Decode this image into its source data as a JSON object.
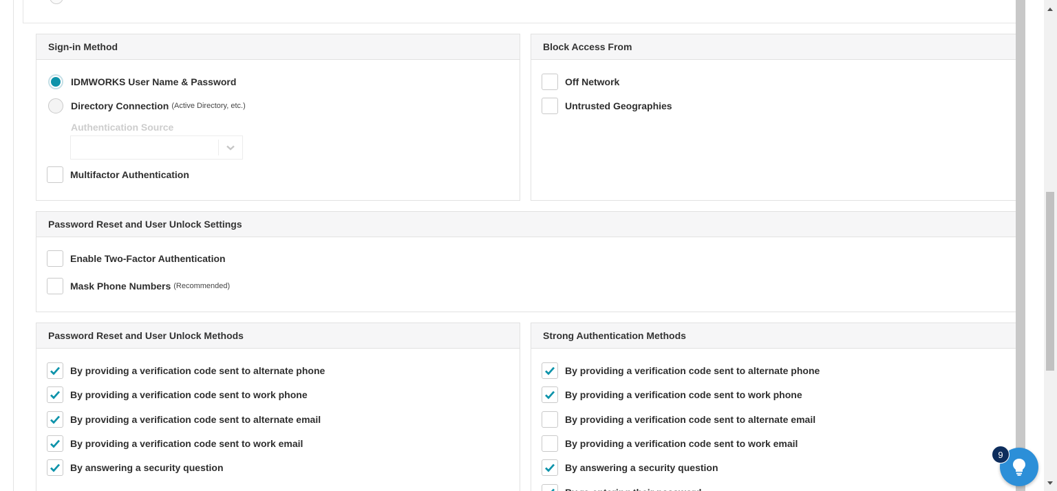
{
  "sign_in": {
    "title": "Sign-in Method",
    "options": [
      {
        "label": "IDMWORKS User Name & Password",
        "note": "",
        "selected": true
      },
      {
        "label": "Directory Connection",
        "note": "(Active Directory, etc.)",
        "selected": false
      }
    ],
    "auth_source_label": "Authentication Source",
    "auth_source_value": "",
    "mfa_label": "Multifactor Authentication",
    "mfa_checked": false
  },
  "block_access": {
    "title": "Block Access From",
    "items": [
      {
        "label": "Off Network",
        "checked": false
      },
      {
        "label": "Untrusted Geographies",
        "checked": false
      }
    ]
  },
  "reset_settings": {
    "title": "Password Reset and User Unlock Settings",
    "items": [
      {
        "label": "Enable Two-Factor Authentication",
        "note": "",
        "checked": false
      },
      {
        "label": "Mask Phone Numbers",
        "note": "(Recommended)",
        "checked": false
      }
    ]
  },
  "reset_methods": {
    "title": "Password Reset and User Unlock Methods",
    "items": [
      {
        "label": "By providing a verification code sent to alternate phone",
        "checked": true
      },
      {
        "label": "By providing a verification code sent to work phone",
        "checked": true
      },
      {
        "label": "By providing a verification code sent to alternate email",
        "checked": true
      },
      {
        "label": "By providing a verification code sent to work email",
        "checked": true
      },
      {
        "label": "By answering a security question",
        "checked": true
      }
    ]
  },
  "strong_auth": {
    "title": "Strong Authentication Methods",
    "items": [
      {
        "label": "By providing a verification code sent to alternate phone",
        "checked": true
      },
      {
        "label": "By providing a verification code sent to work phone",
        "checked": true
      },
      {
        "label": "By providing a verification code sent to alternate email",
        "checked": false
      },
      {
        "label": "By providing a verification code sent to work email",
        "checked": false
      },
      {
        "label": "By answering a security question",
        "checked": true
      },
      {
        "label": "By re-entering their password",
        "checked": true
      }
    ]
  },
  "help": {
    "badge_count": "9",
    "icon": "lightbulb-icon"
  },
  "colors": {
    "accent": "#0d93aa",
    "help_button": "#2c8fd8",
    "badge": "#0d2d5c"
  }
}
